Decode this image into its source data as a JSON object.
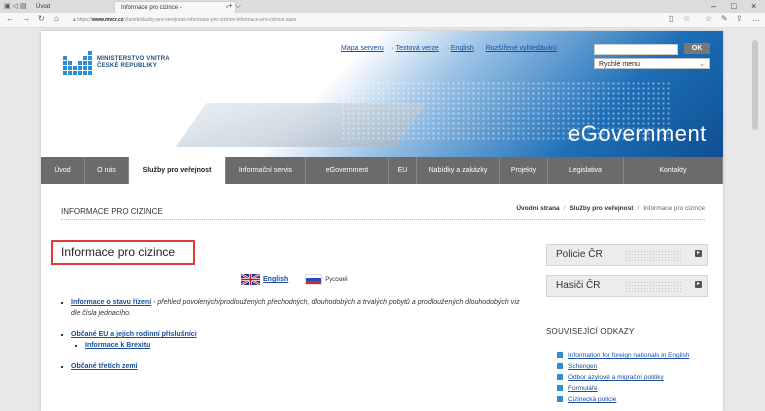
{
  "browser": {
    "tabs": [
      {
        "label": "Úvod"
      },
      {
        "label": "Informace pro cizince -"
      }
    ],
    "url_domain": "www.mvcr.cz",
    "url_prefix": "https://",
    "url_rest": "/clanek/sluzby-pro-verejnost-informace-pro-cizince-informace-pro-cizince.aspx"
  },
  "header": {
    "logo_line1": "MINISTERSTVO VNITRA",
    "logo_line2": "ČESKÉ REPUBLIKY",
    "top_links": [
      "Mapa serveru",
      "Textová verze",
      "English",
      "Rozšířené vyhledávání"
    ],
    "ok_label": "OK",
    "quick_menu": "Rychlé menu",
    "brand": "eGovernment"
  },
  "menu": [
    {
      "label": "Úvod"
    },
    {
      "label": "O nás"
    },
    {
      "label": "Služby pro veřejnost"
    },
    {
      "label": "Informační servis"
    },
    {
      "label": "eGovernment"
    },
    {
      "label": "EU"
    },
    {
      "label": "Nabídky a zakázky"
    },
    {
      "label": "Projekty"
    },
    {
      "label": "Legislativa"
    },
    {
      "label": "Kontakty"
    }
  ],
  "section": {
    "heading": "INFORMACE PRO CIZINCE",
    "breadcrumb": [
      "Úvodní strana",
      "Služby pro veřejnost",
      "Informace pro cizince"
    ]
  },
  "main": {
    "title": "Informace pro cizince",
    "lang_en": "English",
    "lang_ru": "Русский",
    "items": [
      {
        "link": "Informace o stavu řízení",
        "text": " - přehled povolených/prodloužených přechodných, dlouhodobých a trvalých pobytů a prodloužených dlouhodobých víz dle čísla jednacího."
      },
      {
        "link": "Občané EU a jejich rodinní příslušníci",
        "sub": "Informace k Brexitu"
      },
      {
        "link": "Občané třetích zemí"
      }
    ]
  },
  "sidebar": {
    "boxes": [
      "Policie ČR",
      "Hasiči ČR"
    ],
    "related_heading": "SOUVISEJÍCÍ ODKAZY",
    "related": [
      "Information for foreign nationals in English",
      "Schengen",
      "Odbor azylové a migrační politiky",
      "Formuláře",
      "Cizinecká policie"
    ]
  },
  "colors": {
    "menu_bg": "#6b6b6b",
    "link": "#1a4fa0",
    "highlight_border": "#e03b3b",
    "accent_blue": "#2a8fd5"
  }
}
